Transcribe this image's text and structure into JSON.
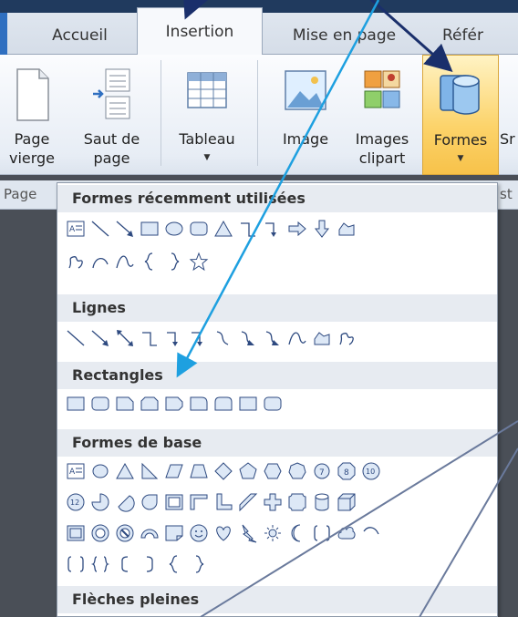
{
  "tabs": [
    {
      "label": "Accueil",
      "active": false
    },
    {
      "label": "Insertion",
      "active": true
    },
    {
      "label": "Mise en page",
      "active": false
    },
    {
      "label": "Référ",
      "active": false
    }
  ],
  "ribbon": {
    "page_vierge_line1": "Page",
    "page_vierge_line2": "vierge",
    "saut_line1": "Saut de",
    "saut_line2": "page",
    "tableau": "Tableau",
    "image": "Image",
    "images_clipart_line1": "Images",
    "images_clipart_line2": "clipart",
    "formes": "Formes",
    "next_cut": "Sr",
    "group_page": "Page",
    "group_cut": "st"
  },
  "gallery": {
    "sections": [
      {
        "title": "Formes récemment utilisées"
      },
      {
        "title": "Lignes"
      },
      {
        "title": "Rectangles"
      },
      {
        "title": "Formes de base"
      },
      {
        "title": "Flèches pleines"
      }
    ]
  },
  "colors": {
    "accent_dark_arrow": "#1a2f6b",
    "accent_light_arrow": "#1ea0e0",
    "active_button": "#fcd36a",
    "shape_stroke": "#2e4a80",
    "shape_fill": "#dde8f6"
  }
}
